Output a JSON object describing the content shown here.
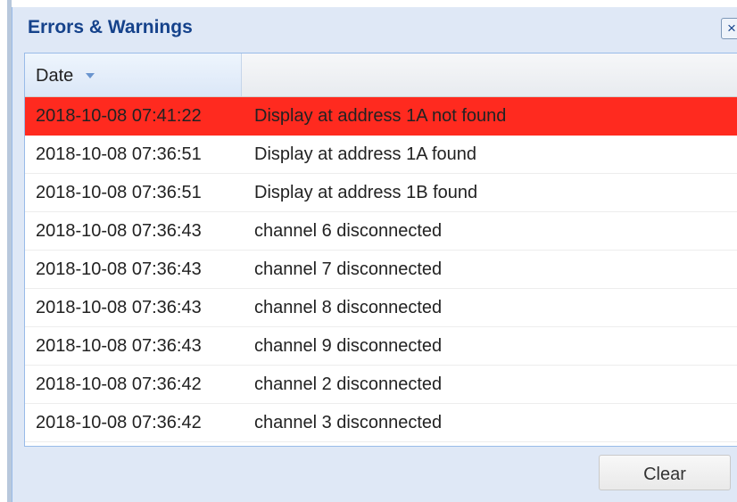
{
  "panel": {
    "title": "Errors & Warnings",
    "close_icon": "×"
  },
  "grid": {
    "columns": [
      {
        "label": "Date",
        "sort": "descending"
      },
      {
        "label": ""
      }
    ],
    "rows": [
      {
        "date": "2018-10-08 07:41:22",
        "message": "Display at address 1A not found",
        "highlight": "#ff2a1f"
      },
      {
        "date": "2018-10-08 07:36:51",
        "message": "Display at address 1A found"
      },
      {
        "date": "2018-10-08 07:36:51",
        "message": "Display at address 1B found"
      },
      {
        "date": "2018-10-08 07:36:43",
        "message": "channel 6 disconnected"
      },
      {
        "date": "2018-10-08 07:36:43",
        "message": "channel 7 disconnected"
      },
      {
        "date": "2018-10-08 07:36:43",
        "message": "channel 8 disconnected"
      },
      {
        "date": "2018-10-08 07:36:43",
        "message": "channel 9 disconnected"
      },
      {
        "date": "2018-10-08 07:36:42",
        "message": "channel 2 disconnected"
      },
      {
        "date": "2018-10-08 07:36:42",
        "message": "channel 3 disconnected"
      }
    ]
  },
  "footer": {
    "clear_label": "Clear"
  }
}
